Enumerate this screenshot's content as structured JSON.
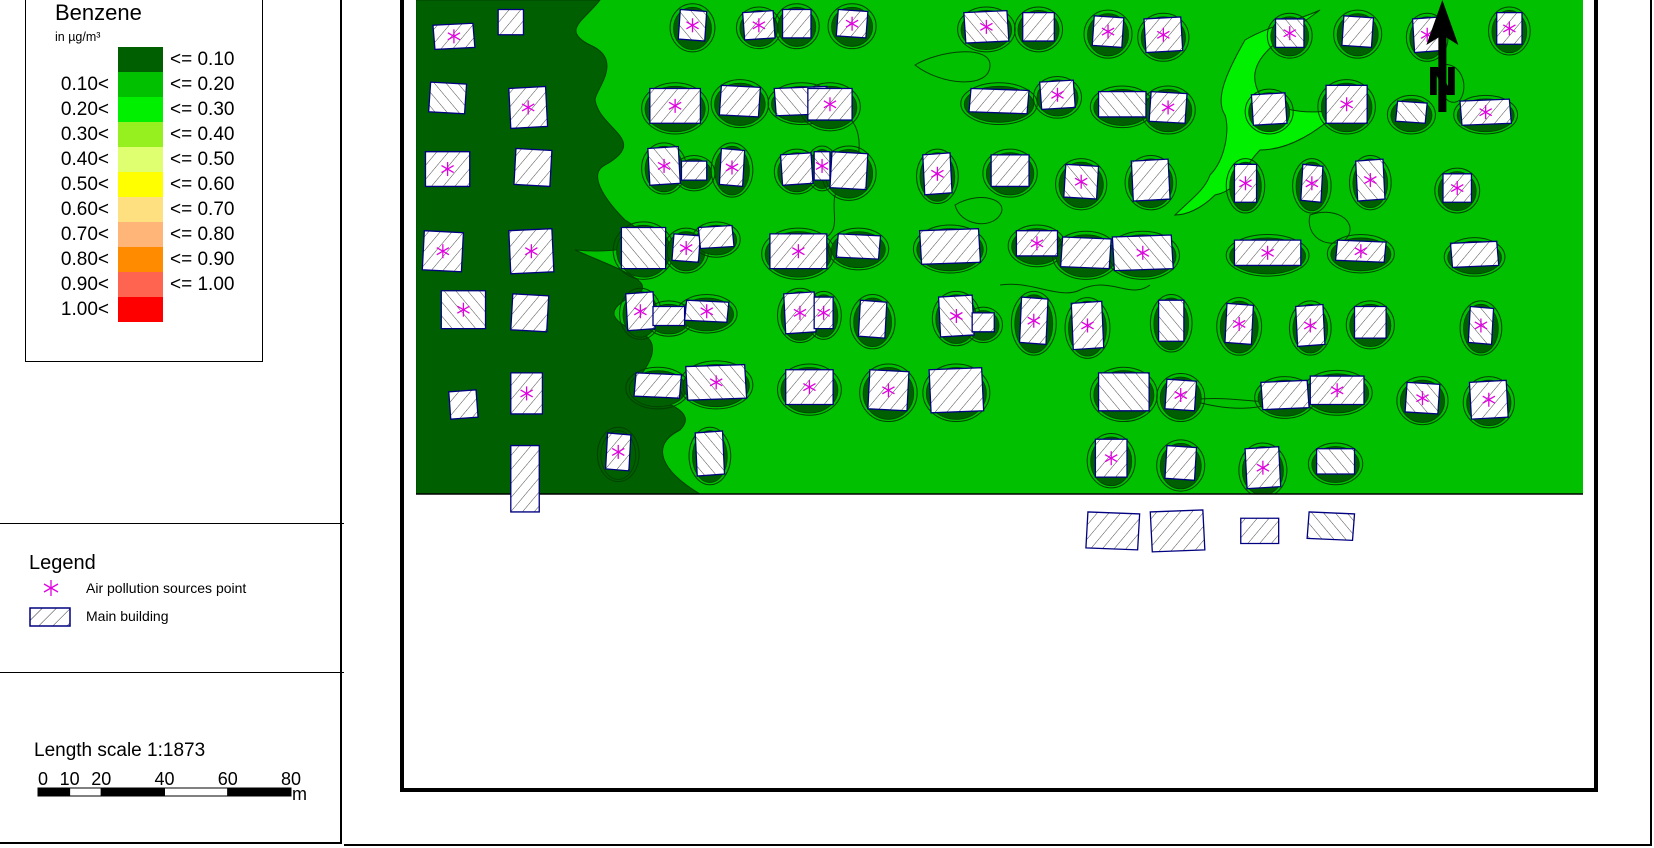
{
  "concentration_legend": {
    "title": "Benzene",
    "unit": "in µg/m³",
    "classes": [
      {
        "lower": "",
        "upper": "<= 0.10",
        "color": "#005f00"
      },
      {
        "lower": "0.10<",
        "upper": "<= 0.20",
        "color": "#00c000"
      },
      {
        "lower": "0.20<",
        "upper": "<= 0.30",
        "color": "#00f000"
      },
      {
        "lower": "0.30<",
        "upper": "<= 0.40",
        "color": "#96f020"
      },
      {
        "lower": "0.40<",
        "upper": "<= 0.50",
        "color": "#e0ff70"
      },
      {
        "lower": "0.50<",
        "upper": "<= 0.60",
        "color": "#ffff00"
      },
      {
        "lower": "0.60<",
        "upper": "<= 0.70",
        "color": "#ffe080"
      },
      {
        "lower": "0.70<",
        "upper": "<= 0.80",
        "color": "#ffb478"
      },
      {
        "lower": "0.80<",
        "upper": "<= 0.90",
        "color": "#ff8c00"
      },
      {
        "lower": "0.90<",
        "upper": "<= 1.00",
        "color": "#ff6450"
      },
      {
        "lower": "1.00<",
        "upper": "",
        "color": "#ff0000"
      }
    ]
  },
  "feature_legend": {
    "title": "Legend",
    "items": [
      {
        "icon": "asterisk-icon",
        "label": "Air pollution sources point",
        "color": "#e000e0"
      },
      {
        "icon": "hatched-rect-icon",
        "label": "Main building",
        "color": "#000080"
      }
    ]
  },
  "scale": {
    "title": "Length scale 1:1873",
    "ticks": [
      "0",
      "10",
      "20",
      "40",
      "60",
      "80"
    ],
    "unit": "m"
  },
  "map": {
    "north_label": "N",
    "colors": {
      "low": "#005f00",
      "mid": "#00c000",
      "high": "#00f000",
      "contour": "#004000",
      "building_outline": "#000080",
      "source": "#e000e0"
    },
    "buildings": [
      [
        6,
        8,
        12,
        7,
        1
      ],
      [
        26,
        3,
        8,
        8,
        0
      ],
      [
        83,
        3,
        9,
        10,
        1
      ],
      [
        104,
        4,
        9,
        8,
        1
      ],
      [
        116,
        3,
        9,
        9,
        0
      ],
      [
        133,
        3,
        10,
        9,
        1
      ],
      [
        174,
        4,
        13,
        9,
        1
      ],
      [
        192,
        4,
        10,
        9,
        0
      ],
      [
        214,
        5,
        10,
        10,
        1
      ],
      [
        231,
        6,
        11,
        10,
        1
      ],
      [
        272,
        6,
        9,
        9,
        1
      ],
      [
        293,
        5,
        10,
        10,
        0
      ],
      [
        316,
        6,
        8,
        10,
        1
      ],
      [
        342,
        4,
        8,
        10,
        1
      ],
      [
        4,
        26,
        12,
        10,
        0
      ],
      [
        30,
        28,
        11,
        12,
        1
      ],
      [
        74,
        28,
        16,
        11,
        1
      ],
      [
        96,
        27,
        13,
        10,
        0
      ],
      [
        114,
        28,
        16,
        8,
        0
      ],
      [
        124,
        28,
        14,
        10,
        1
      ],
      [
        175,
        28,
        19,
        8,
        0
      ],
      [
        198,
        26,
        10,
        8,
        1
      ],
      [
        216,
        29,
        15,
        8,
        0
      ],
      [
        232,
        29,
        12,
        10,
        1
      ],
      [
        265,
        30,
        10,
        9,
        0
      ],
      [
        288,
        27,
        13,
        12,
        1
      ],
      [
        310,
        32,
        10,
        7,
        0
      ],
      [
        331,
        32,
        15,
        7,
        1
      ],
      [
        3,
        48,
        14,
        11,
        1
      ],
      [
        31,
        47,
        12,
        12,
        0
      ],
      [
        74,
        47,
        9,
        11,
        1
      ],
      [
        84,
        51,
        8,
        6,
        0
      ],
      [
        96,
        47,
        8,
        12,
        1
      ],
      [
        116,
        49,
        9,
        9,
        0
      ],
      [
        126,
        48,
        5,
        9,
        1
      ],
      [
        131,
        48,
        12,
        12,
        0
      ],
      [
        161,
        49,
        8,
        12,
        1
      ],
      [
        182,
        49,
        12,
        10,
        0
      ],
      [
        205,
        52,
        11,
        11,
        1
      ],
      [
        227,
        51,
        11,
        12,
        0
      ],
      [
        259,
        52,
        7,
        12,
        1
      ],
      [
        280,
        52,
        7,
        12,
        1
      ],
      [
        298,
        51,
        8,
        12,
        1
      ],
      [
        325,
        55,
        9,
        9,
        1
      ],
      [
        2,
        73,
        13,
        13,
        1
      ],
      [
        30,
        73,
        13,
        13,
        1
      ],
      [
        65,
        72,
        14,
        13,
        0
      ],
      [
        81,
        74,
        9,
        9,
        1
      ],
      [
        90,
        72,
        10,
        6,
        0
      ],
      [
        112,
        74,
        18,
        11,
        1
      ],
      [
        133,
        74,
        14,
        8,
        0
      ],
      [
        160,
        73,
        18,
        10,
        0
      ],
      [
        190,
        73,
        13,
        8,
        1
      ],
      [
        204,
        75,
        16,
        10,
        0
      ],
      [
        221,
        75,
        18,
        10,
        1
      ],
      [
        259,
        76,
        21,
        8,
        1
      ],
      [
        291,
        76,
        16,
        7,
        1
      ],
      [
        328,
        77,
        14,
        7,
        0
      ],
      [
        8,
        92,
        14,
        12,
        1
      ],
      [
        30,
        93,
        12,
        12,
        0
      ],
      [
        67,
        93,
        8,
        11,
        1
      ],
      [
        75,
        97,
        10,
        6,
        0
      ],
      [
        85,
        95,
        14,
        7,
        1
      ],
      [
        117,
        93,
        9,
        12,
        1
      ],
      [
        126,
        94,
        6,
        10,
        1
      ],
      [
        140,
        95,
        9,
        12,
        0
      ],
      [
        166,
        94,
        10,
        12,
        1
      ],
      [
        176,
        99,
        7,
        6,
        0
      ],
      [
        191,
        94,
        9,
        15,
        1
      ],
      [
        208,
        96,
        9,
        14,
        1
      ],
      [
        235,
        95,
        8,
        13,
        0
      ],
      [
        256,
        96,
        9,
        13,
        1
      ],
      [
        279,
        97,
        8,
        12,
        1
      ],
      [
        297,
        97,
        10,
        10,
        0
      ],
      [
        333,
        97,
        8,
        12,
        1
      ],
      [
        11,
        124,
        8,
        8,
        0
      ],
      [
        30,
        118,
        10,
        13,
        1
      ],
      [
        69,
        118,
        15,
        8,
        0
      ],
      [
        86,
        116,
        18,
        10,
        1
      ],
      [
        117,
        117,
        15,
        11,
        1
      ],
      [
        143,
        117,
        13,
        13,
        1
      ],
      [
        163,
        117,
        16,
        13,
        0
      ],
      [
        216,
        118,
        16,
        12,
        0
      ],
      [
        237,
        120,
        10,
        10,
        1
      ],
      [
        268,
        121,
        14,
        8,
        0
      ],
      [
        283,
        119,
        17,
        9,
        1
      ],
      [
        313,
        121,
        11,
        10,
        1
      ],
      [
        334,
        121,
        11,
        11,
        1
      ],
      [
        30,
        141,
        9,
        21,
        0
      ],
      [
        60,
        137,
        8,
        12,
        1
      ],
      [
        89,
        137,
        8,
        13,
        0
      ],
      [
        215,
        139,
        10,
        12,
        1
      ],
      [
        237,
        141,
        10,
        11,
        0
      ],
      [
        263,
        142,
        10,
        12,
        1
      ],
      [
        285,
        142,
        12,
        8,
        0
      ],
      [
        212,
        162,
        17,
        12,
        0
      ],
      [
        233,
        162,
        16,
        12,
        0
      ],
      [
        261,
        164,
        12,
        8,
        0
      ],
      [
        282,
        162,
        15,
        9,
        0
      ]
    ],
    "north_arrow_pos_m": [
      321,
      0
    ]
  }
}
